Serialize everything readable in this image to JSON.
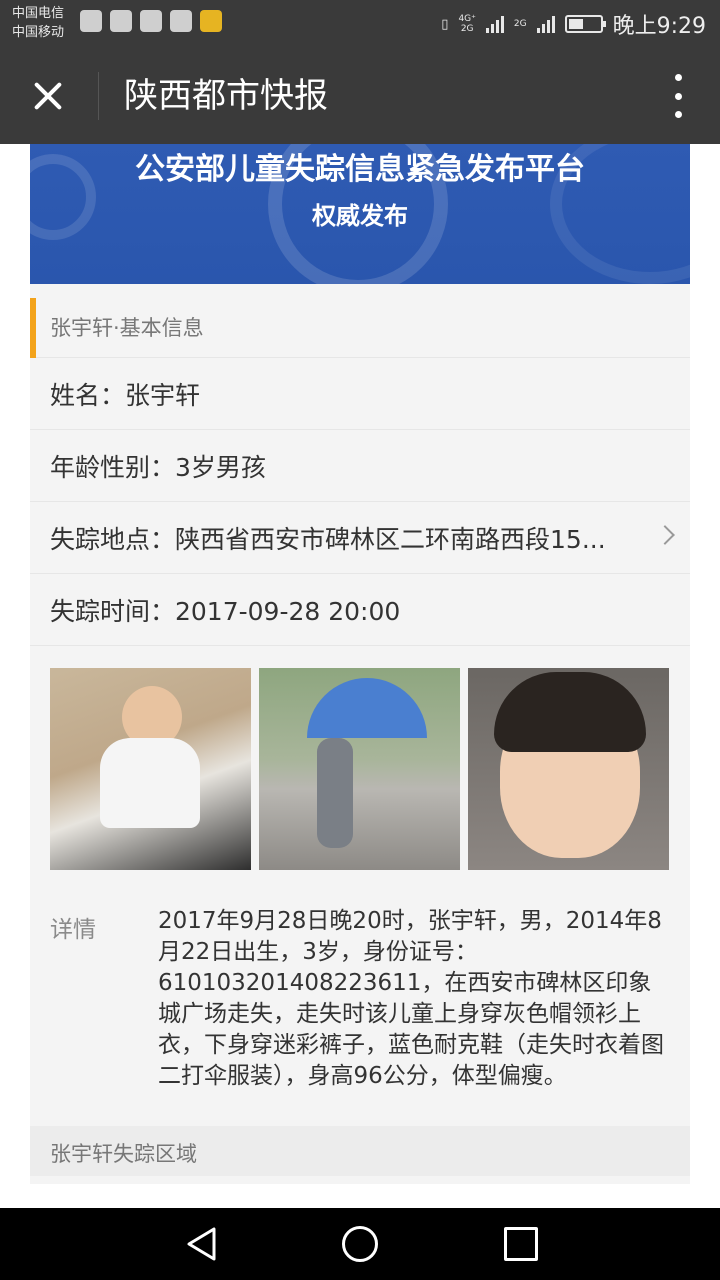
{
  "status_bar": {
    "carrier_1": "中国电信",
    "carrier_2": "中国移动",
    "net_1": "4G⁺",
    "net_1b": "2G",
    "net_2": "2G",
    "battery_level": 0.45,
    "time": "晚上9:29"
  },
  "title_bar": {
    "title": "陕西都市快报"
  },
  "banner": {
    "title": "公安部儿童失踪信息紧急发布平台",
    "subtitle": "权威发布"
  },
  "section": {
    "basic_info_label": "张宇轩·基本信息"
  },
  "rows": [
    {
      "text": "姓名：张宇轩"
    },
    {
      "text": "年龄性别：3岁男孩"
    },
    {
      "text": "失踪地点：陕西省西安市碑林区二环南路西段15..."
    },
    {
      "text": "失踪时间：2017-09-28 20:00"
    }
  ],
  "detail": {
    "label": "详情",
    "text": "2017年9月28日晚20时，张宇轩，男，2014年8月22日出生，3岁，身份证号：610103201408223611，在西安市碑林区印象城广场走失，走失时该儿童上身穿灰色帽领衫上衣，下身穿迷彩裤子，蓝色耐克鞋（走失时衣着图二打伞服装），身高96公分，体型偏瘦。"
  },
  "region": {
    "label": "张宇轩失踪区域"
  },
  "colors": {
    "banner_blue": "#2f5bb3",
    "accent_orange": "#f3a31b",
    "bar_dark": "#3a3a3a"
  },
  "icons": {
    "close": "close-icon",
    "more": "more-vertical-icon",
    "chevron": "chevron-right-icon",
    "nav_back": "back-triangle-icon",
    "nav_home": "home-circle-icon",
    "nav_recent": "recent-square-icon"
  }
}
